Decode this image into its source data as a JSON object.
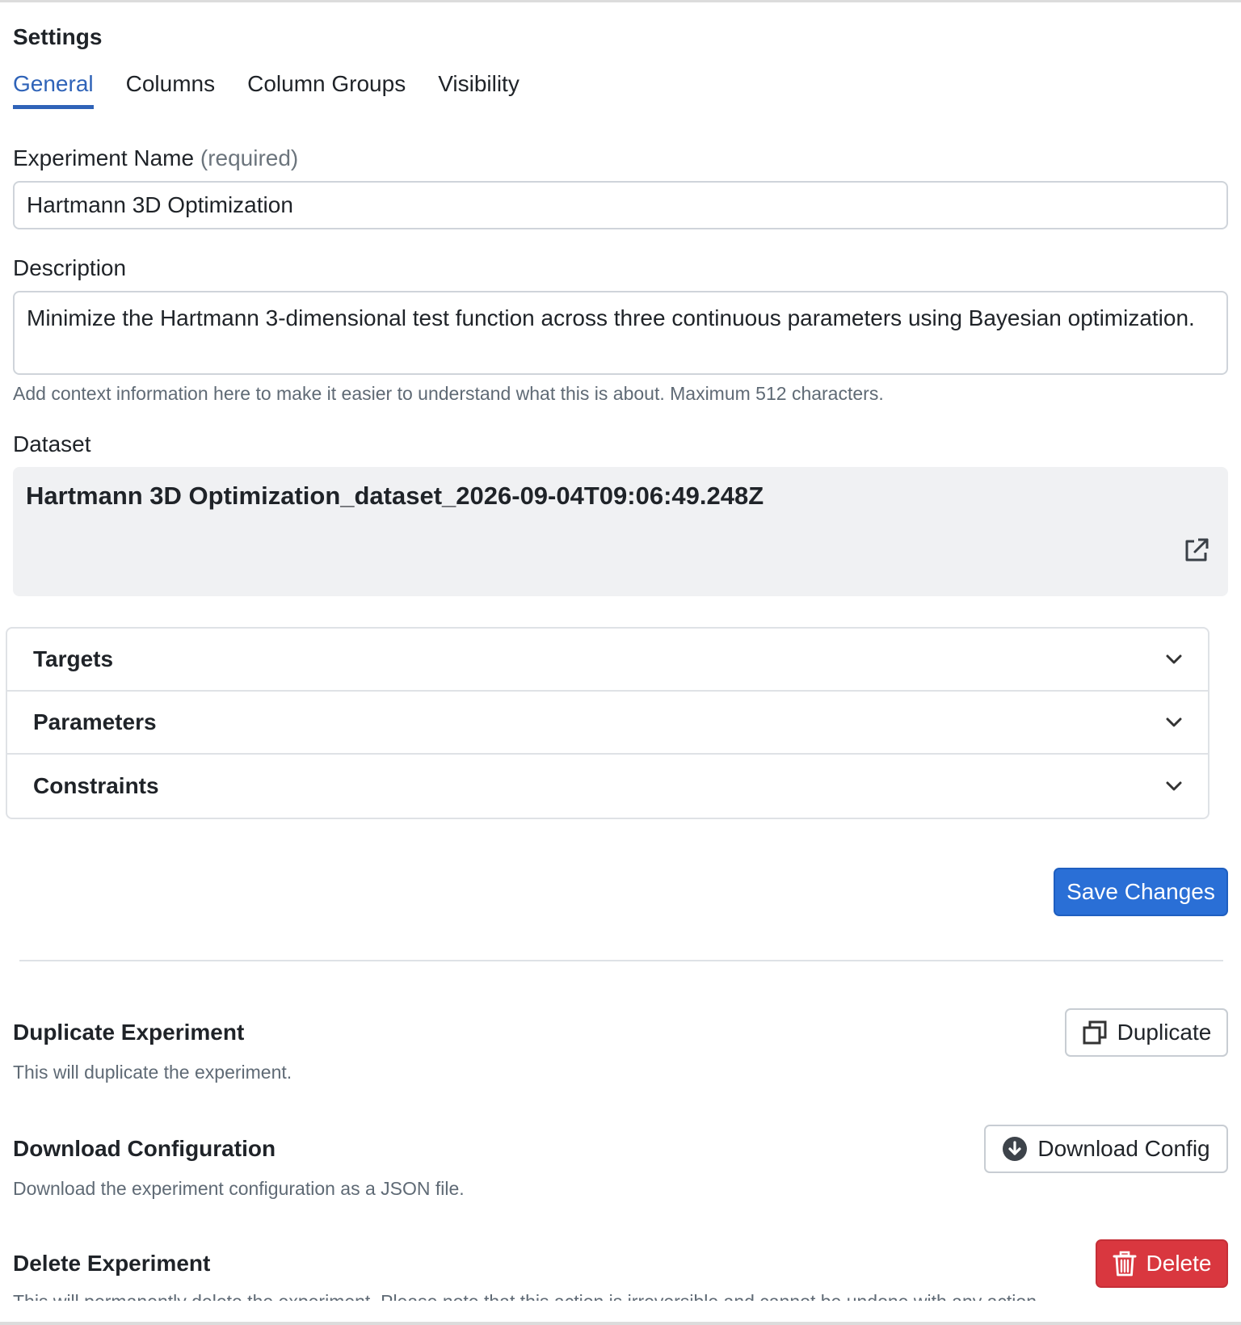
{
  "settings": {
    "title": "Settings"
  },
  "tabs": [
    {
      "label": "General",
      "active": true
    },
    {
      "label": "Columns",
      "active": false
    },
    {
      "label": "Column Groups",
      "active": false
    },
    {
      "label": "Visibility",
      "active": false
    }
  ],
  "experiment_name": {
    "label": "Experiment Name",
    "required_note": "(required)",
    "value": "Hartmann 3D Optimization"
  },
  "description": {
    "label": "Description",
    "value": "Minimize the Hartmann 3-dimensional test function across three continuous parameters using Bayesian optimization.",
    "help": "Add context information here to make it easier to understand what this is about. Maximum 512 characters."
  },
  "dataset": {
    "label": "Dataset",
    "name": "Hartmann 3D Optimization_dataset_2026-09-04T09:06:49.248Z",
    "link_icon": "external-link-icon"
  },
  "accordion": [
    {
      "title": "Targets",
      "icon": "chevron-down-icon"
    },
    {
      "title": "Parameters",
      "icon": "chevron-down-icon"
    },
    {
      "title": "Constraints",
      "icon": "chevron-down-icon"
    }
  ],
  "actions": {
    "save_label": "Save Changes"
  },
  "duplicate": {
    "title": "Duplicate Experiment",
    "description": "This will duplicate the experiment.",
    "button_label": "Duplicate",
    "icon": "duplicate-icon"
  },
  "download": {
    "title": "Download Configuration",
    "description": "Download the experiment configuration as a JSON file.",
    "button_label": "Download Config",
    "icon": "download-icon"
  },
  "delete": {
    "title": "Delete Experiment",
    "description": "This will permanently delete the experiment. Please note that this action is irreversible and cannot be undone with any action.",
    "button_label": "Delete",
    "icon": "trash-icon"
  },
  "colors": {
    "accent": "#2f63b8",
    "primary_button": "#2a6fd6",
    "danger_button": "#d9373f",
    "dataset_bg": "#f0f1f3"
  }
}
